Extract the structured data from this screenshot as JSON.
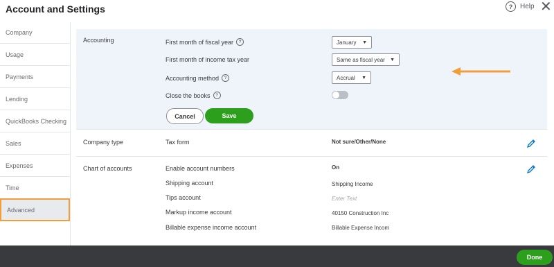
{
  "header": {
    "title": "Account and Settings",
    "help_label": "Help",
    "help_glyph": "?",
    "close_glyph": "✕"
  },
  "sidebar": {
    "items": [
      {
        "label": "Company"
      },
      {
        "label": "Usage"
      },
      {
        "label": "Payments"
      },
      {
        "label": "Lending"
      },
      {
        "label": "QuickBooks Checking"
      },
      {
        "label": "Sales"
      },
      {
        "label": "Expenses"
      },
      {
        "label": "Time"
      },
      {
        "label": "Advanced",
        "active": true
      }
    ]
  },
  "accounting": {
    "section_title": "Accounting",
    "fiscal_year_label": "First month of fiscal year",
    "fiscal_year_value": "January",
    "tax_year_label": "First month of income tax year",
    "tax_year_value": "Same as fiscal year",
    "method_label": "Accounting method",
    "method_value": "Accrual",
    "close_books_label": "Close the books",
    "close_books_on": false,
    "cancel_label": "Cancel",
    "save_label": "Save",
    "info_glyph": "?",
    "dropdown_glyph": "▼"
  },
  "company_type": {
    "section_title": "Company type",
    "tax_form_label": "Tax form",
    "tax_form_value": "Not sure/Other/None"
  },
  "chart_of_accounts": {
    "section_title": "Chart of accounts",
    "rows": [
      {
        "label": "Enable account numbers",
        "value": "On"
      },
      {
        "label": "Shipping account",
        "value": "Shipping Income"
      },
      {
        "label": "Tips account",
        "value": "Enter Text"
      },
      {
        "label": "Markup income account",
        "value": "40150 Construction Inc"
      },
      {
        "label": "Billable expense income account",
        "value": "Billable Expense Incom"
      }
    ]
  },
  "footer": {
    "done_label": "Done"
  },
  "colors": {
    "accent_green": "#2ca01c",
    "highlight_orange": "#f19e3a",
    "section_bg": "#eff4fa",
    "footer_bg": "#393a3d"
  },
  "icons": [
    "help-icon",
    "close-icon",
    "info-icon",
    "dropdown-caret-icon",
    "pencil-icon",
    "arrow-annotation-icon"
  ]
}
